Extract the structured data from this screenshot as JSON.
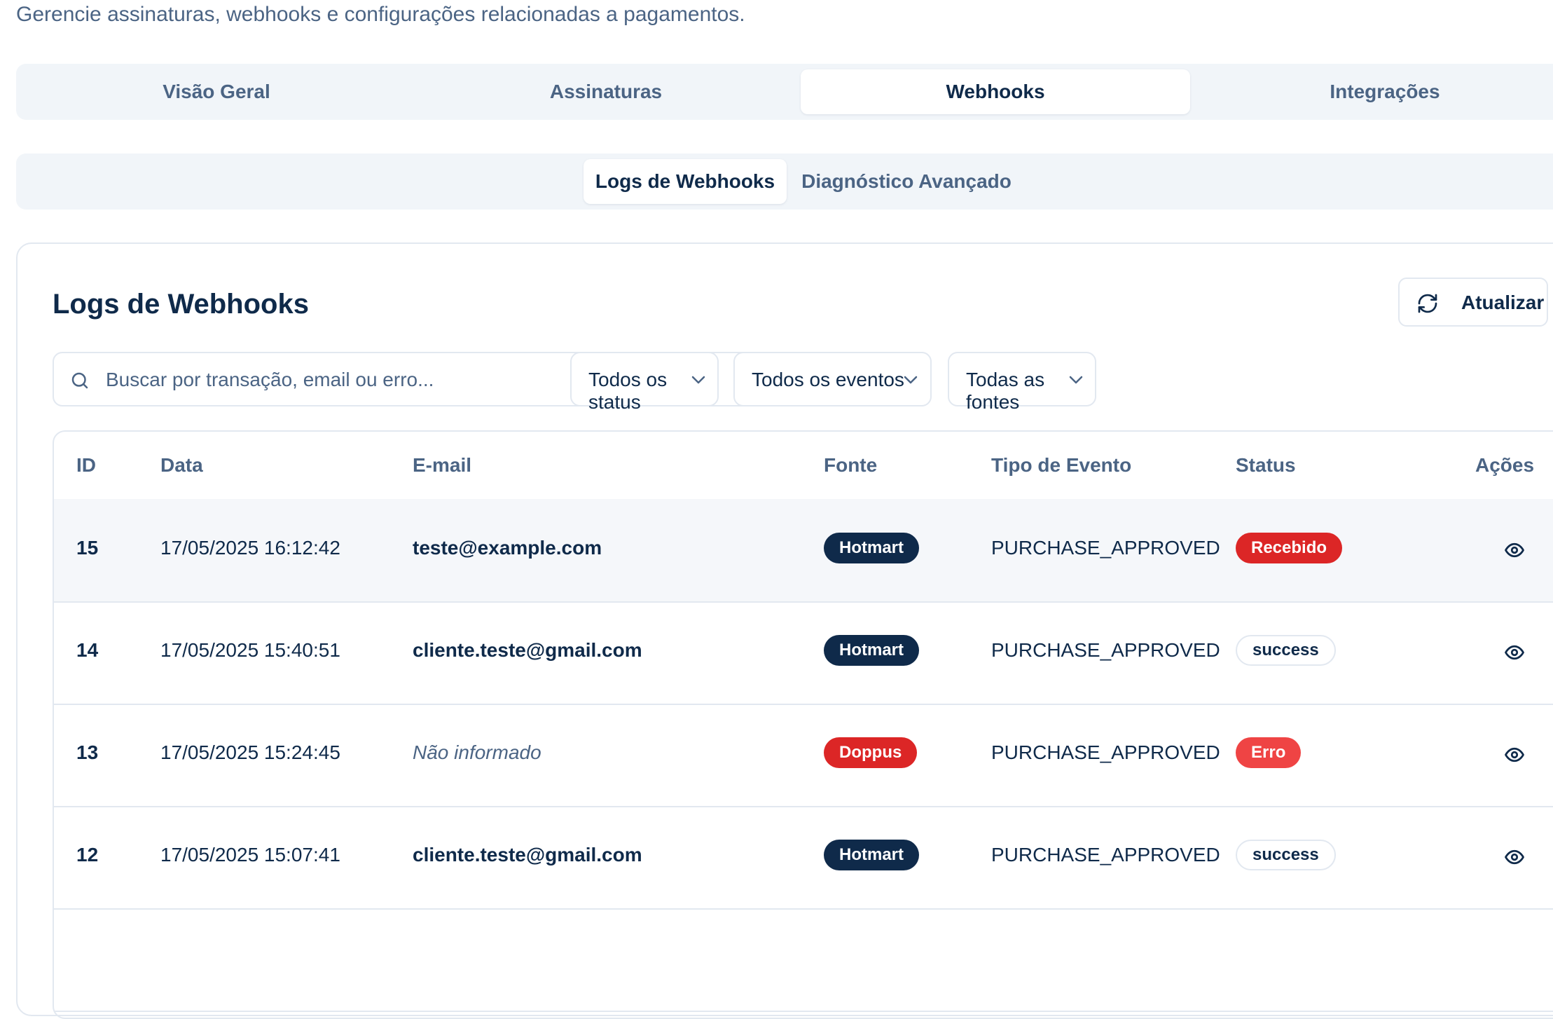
{
  "page": {
    "subtitle": "Gerencie assinaturas, webhooks e configurações relacionadas a pagamentos."
  },
  "tabs": [
    {
      "label": "Visão Geral",
      "active": false
    },
    {
      "label": "Assinaturas",
      "active": false
    },
    {
      "label": "Webhooks",
      "active": true
    },
    {
      "label": "Integrações",
      "active": false
    }
  ],
  "subtabs": [
    {
      "label": "Logs de Webhooks",
      "active": true
    },
    {
      "label": "Diagnóstico Avançado",
      "active": false
    }
  ],
  "card": {
    "title": "Logs de Webhooks",
    "refresh_label": "Atualizar",
    "refresh_icon": "refresh-icon"
  },
  "filters": {
    "search_placeholder": "Buscar por transação, email ou erro...",
    "status": "Todos os status",
    "events": "Todos os eventos",
    "sources": "Todas as fontes"
  },
  "table": {
    "columns": [
      "ID",
      "Data",
      "E-mail",
      "Fonte",
      "Tipo de Evento",
      "Status",
      "Ações"
    ],
    "rows": [
      {
        "id": "15",
        "date": "17/05/2025 16:12:42",
        "email": "teste@example.com",
        "source": "Hotmart",
        "event": "PURCHASE_APPROVED",
        "status": "Recebido"
      },
      {
        "id": "14",
        "date": "17/05/2025 15:40:51",
        "email": "cliente.teste@gmail.com",
        "source": "Hotmart",
        "event": "PURCHASE_APPROVED",
        "status": "success"
      },
      {
        "id": "13",
        "date": "17/05/2025 15:24:45",
        "email": "Não informado",
        "source": "Doppus",
        "event": "PURCHASE_APPROVED",
        "status": "Erro"
      },
      {
        "id": "12",
        "date": "17/05/2025 15:07:41",
        "email": "cliente.teste@gmail.com",
        "source": "Hotmart",
        "event": "PURCHASE_APPROVED",
        "status": "success"
      }
    ],
    "action_icon": "eye-icon"
  },
  "colors": {
    "navy": "#0f2a4a",
    "muted": "#4b6484",
    "danger": "#dc2626",
    "danger_light": "#ef4444",
    "border": "#e2e8f0",
    "tab_bg": "#f1f5f9"
  }
}
